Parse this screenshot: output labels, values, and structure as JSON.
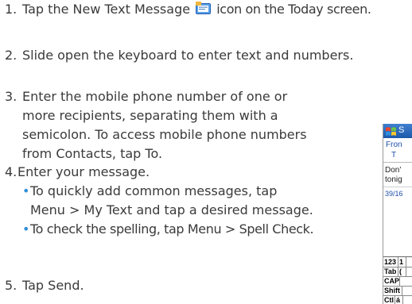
{
  "steps": [
    {
      "num": "1.",
      "text_before": "Tap the New Text Message",
      "text_after": "icon on the Today screen."
    },
    {
      "num": "2.",
      "text": "Slide open the keyboard to enter text and numbers."
    },
    {
      "num": "3.",
      "lines": [
        "Enter the mobile phone number of one or",
        "more recipients, separating them with a",
        "semicolon. To access mobile phone numbers",
        "from Contacts, tap To."
      ]
    },
    {
      "num": "4.",
      "text": "Enter your message."
    },
    {
      "num": "5.",
      "text": "Tap Send."
    }
  ],
  "bullets": [
    {
      "lines": [
        "To quickly add common messages, tap",
        "Menu > My Text and tap a desired message."
      ]
    },
    {
      "lines": [
        "To check the spelling, tap Menu > Spell Check."
      ]
    }
  ],
  "icons": {
    "message_icon": "new-text-message-icon",
    "windows_flag": "windows-flag-icon"
  },
  "phone": {
    "title": "S",
    "from_label": "Fron",
    "to_label": "T",
    "body_lines": [
      "Don'",
      "tonig"
    ],
    "char_count": "39/16",
    "keyboard": [
      [
        "123",
        "1"
      ],
      [
        "Tab",
        "("
      ],
      [
        "CAP",
        ""
      ],
      [
        "Shift",
        ""
      ],
      [
        "Ctl",
        "á"
      ]
    ]
  },
  "colors": {
    "text": "#3a3a3a",
    "bullet": "#2f8fd6",
    "titlebar": "#1d58a8"
  }
}
